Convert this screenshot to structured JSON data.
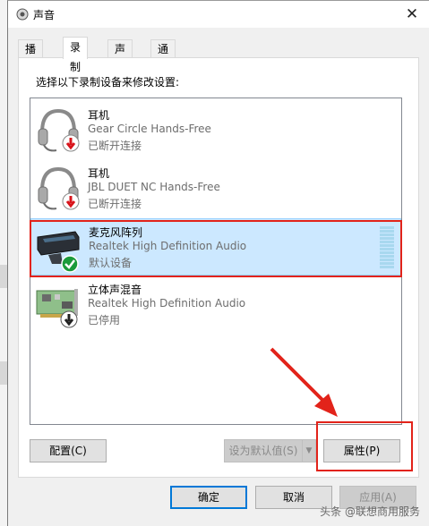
{
  "window": {
    "title": "声音",
    "close_glyph": "✕"
  },
  "tabs": [
    {
      "label": "播放"
    },
    {
      "label": "录制",
      "active": true
    },
    {
      "label": "声音"
    },
    {
      "label": "通信"
    }
  ],
  "instruction": "选择以下录制设备来修改设置:",
  "devices": [
    {
      "name": "耳机",
      "description": "Gear Circle Hands-Free",
      "status": "已断开连接",
      "icon": "headset-icon",
      "badge": "disconnected-badge-icon"
    },
    {
      "name": "耳机",
      "description": "JBL DUET NC Hands-Free",
      "status": "已断开连接",
      "icon": "headset-icon",
      "badge": "disconnected-badge-icon"
    },
    {
      "name": "麦克风阵列",
      "description": "Realtek High Definition Audio",
      "status": "默认设备",
      "icon": "microphone-array-icon",
      "badge": "default-check-badge-icon",
      "selected": true
    },
    {
      "name": "立体声混音",
      "description": "Realtek High Definition Audio",
      "status": "已停用",
      "icon": "sound-card-icon",
      "badge": "disabled-badge-icon"
    }
  ],
  "buttons": {
    "configure": "配置(C)",
    "set_default": "设为默认值(S)",
    "properties": "属性(P)",
    "ok": "确定",
    "cancel": "取消",
    "apply": "应用(A)"
  },
  "watermark": "头条 @联想商用服务",
  "colors": {
    "selection": "#cce8ff",
    "annotation": "#e2231a",
    "focus": "#0078d7"
  }
}
